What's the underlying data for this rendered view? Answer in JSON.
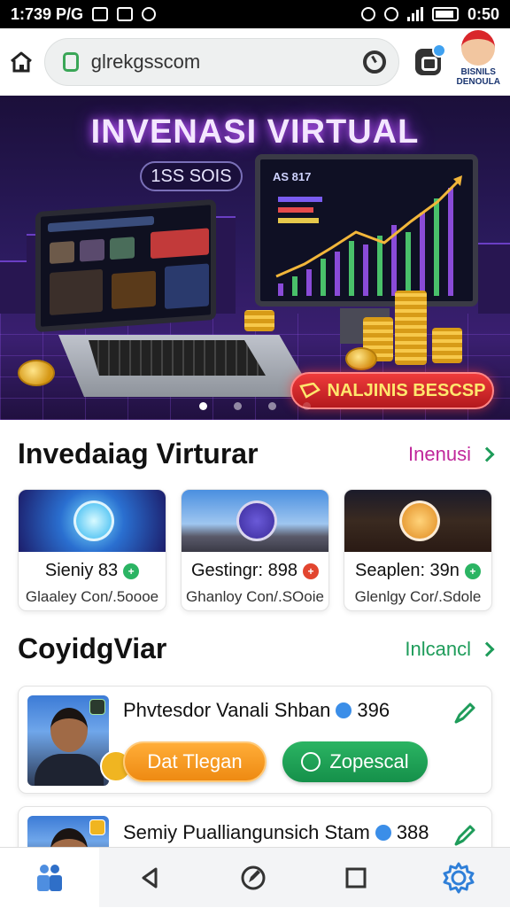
{
  "status_bar": {
    "time": "1:739 P/G",
    "battery": "0:50"
  },
  "browser": {
    "url": "glrekgsscom",
    "brand_line1": "BISNILS",
    "brand_line2": "DENOULA"
  },
  "hero": {
    "title": "INVENASI VIRTUAL",
    "pill": "1SS SOIS",
    "monitor_header": "AS 817",
    "cta": "NALJINIS BESCSP",
    "slides": 4,
    "active_slide": 1
  },
  "section1": {
    "title": "Invedaiag Virturar",
    "link": "Inenusi",
    "link_color": "#c0279b",
    "cards": [
      {
        "title": "Sieniy 83",
        "badge": "+",
        "badge_color": "#2bb463",
        "subtitle": "Glaaley Con/.5oooe"
      },
      {
        "title": "Gestingr: 898",
        "badge": "+",
        "badge_color": "#e2452f",
        "subtitle": "Ghanloy Con/.SOoie"
      },
      {
        "title": "Seaplen: 39n",
        "badge": "+",
        "badge_color": "#2bb463",
        "subtitle": "Glenlgy Cor/.Sdole"
      }
    ]
  },
  "section2": {
    "title": "CoyidgViar",
    "link": "Inlcancl",
    "link_color": "#1e9c5a",
    "items": [
      {
        "name": "Phvtesdor Vanali Shban",
        "score": "396",
        "primary": "Dat Tlegan",
        "secondary": "Zopescal"
      },
      {
        "name": "Semiy Pualliangunsich Stam",
        "score": "388"
      }
    ]
  },
  "colors": {
    "accent_purple": "#8a35e6",
    "accent_green": "#2bb463",
    "accent_orange": "#ee8a12",
    "nav_blue": "#2f7fd8"
  }
}
